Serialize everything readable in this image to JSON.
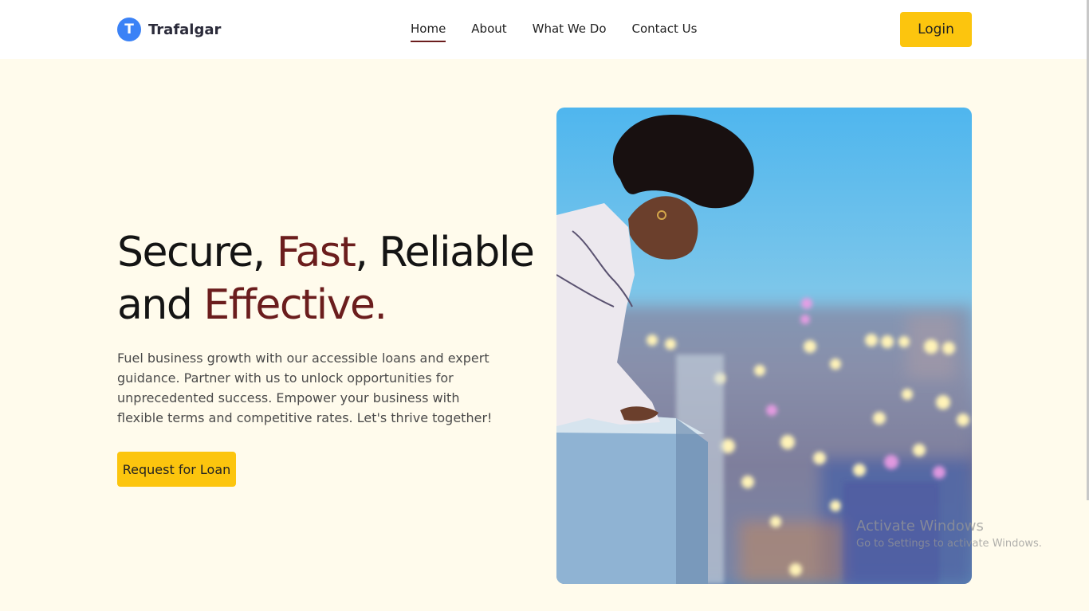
{
  "header": {
    "brand_letter": "T",
    "brand_name": "Trafalgar",
    "nav": [
      "Home",
      "About",
      "What We Do",
      "Contact Us"
    ],
    "active_nav": "Home",
    "login_label": "Login"
  },
  "hero": {
    "title_part1": "Secure, ",
    "title_fast": "Fast",
    "title_part2": ", Reliable and ",
    "title_effective": "Effective.",
    "description": "Fuel business growth with our accessible loans and expert guidance. Partner with us to unlock opportunities for unprecedented success. Empower your business with flexible terms and competitive rates. Let's thrive together!",
    "cta_label": "Request for Loan",
    "image_subject": "woman-looking-over-balcony-city-lights"
  },
  "watermark": {
    "title": "Activate Windows",
    "subtitle": "Go to Settings to activate Windows."
  },
  "colors": {
    "page_bg": "#fffbec",
    "accent": "#6b1d1d",
    "button": "#fcc50e",
    "brand_icon": "#3b82f6"
  }
}
